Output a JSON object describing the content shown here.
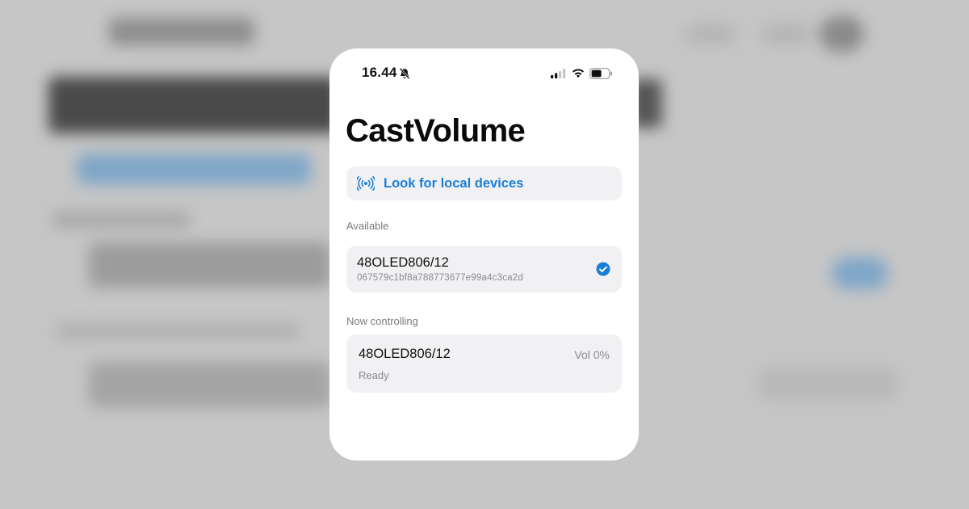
{
  "status_bar": {
    "time": "16.44",
    "icons": [
      "bell-off-icon",
      "cellular-signal-icon",
      "wifi-icon",
      "battery-icon"
    ]
  },
  "app": {
    "title": "CastVolume"
  },
  "discovery": {
    "button_label": "Look for local devices",
    "icon": "antenna-broadcast-icon",
    "accent_color": "#1a7fd8"
  },
  "available": {
    "section_label": "Available",
    "devices": [
      {
        "name": "48OLED806/12",
        "id": "067579c1bf8a788773677e99a4c3ca2d",
        "selected": true,
        "selected_icon": "checkmark-circle-icon"
      }
    ]
  },
  "now_controlling": {
    "section_label": "Now controlling",
    "device_name": "48OLED806/12",
    "volume_text": "Vol 0%",
    "status_text": "Ready"
  },
  "colors": {
    "card_background": "#f1f1f3",
    "secondary_text": "#8b8b90",
    "check_blue": "#1a7fd8"
  }
}
